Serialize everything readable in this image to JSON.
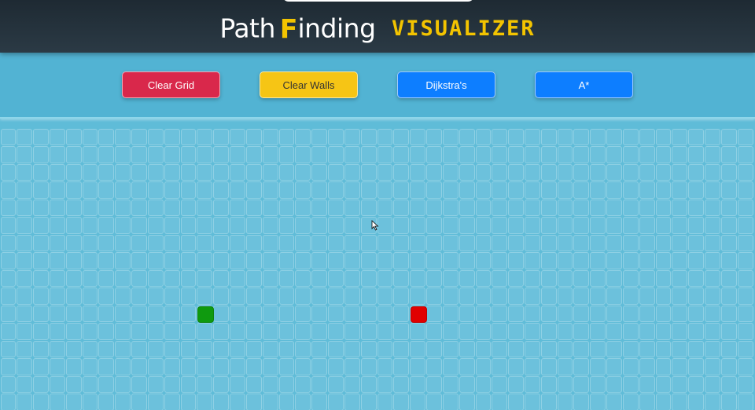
{
  "header": {
    "title_part1": "Path",
    "title_highlight": "F",
    "title_part2": "inding",
    "title_accent": "VISUALIZER"
  },
  "toolbar": {
    "clear_grid_label": "Clear Grid",
    "clear_walls_label": "Clear Walls",
    "dijkstra_label": "Dijkstra's",
    "astar_label": "A*"
  },
  "colors": {
    "header_bg": "#1e2a33",
    "accent_yellow": "#f3c400",
    "clear_grid_red": "#d9284b",
    "clear_walls_yellow": "#f6c515",
    "algorithm_blue": "#0d7eff",
    "grid_bg": "#5fbcd8",
    "start_node": "#0f9a0f",
    "target_node": "#e00000"
  },
  "icons": {
    "cursor": "mouse-pointer-icon"
  }
}
